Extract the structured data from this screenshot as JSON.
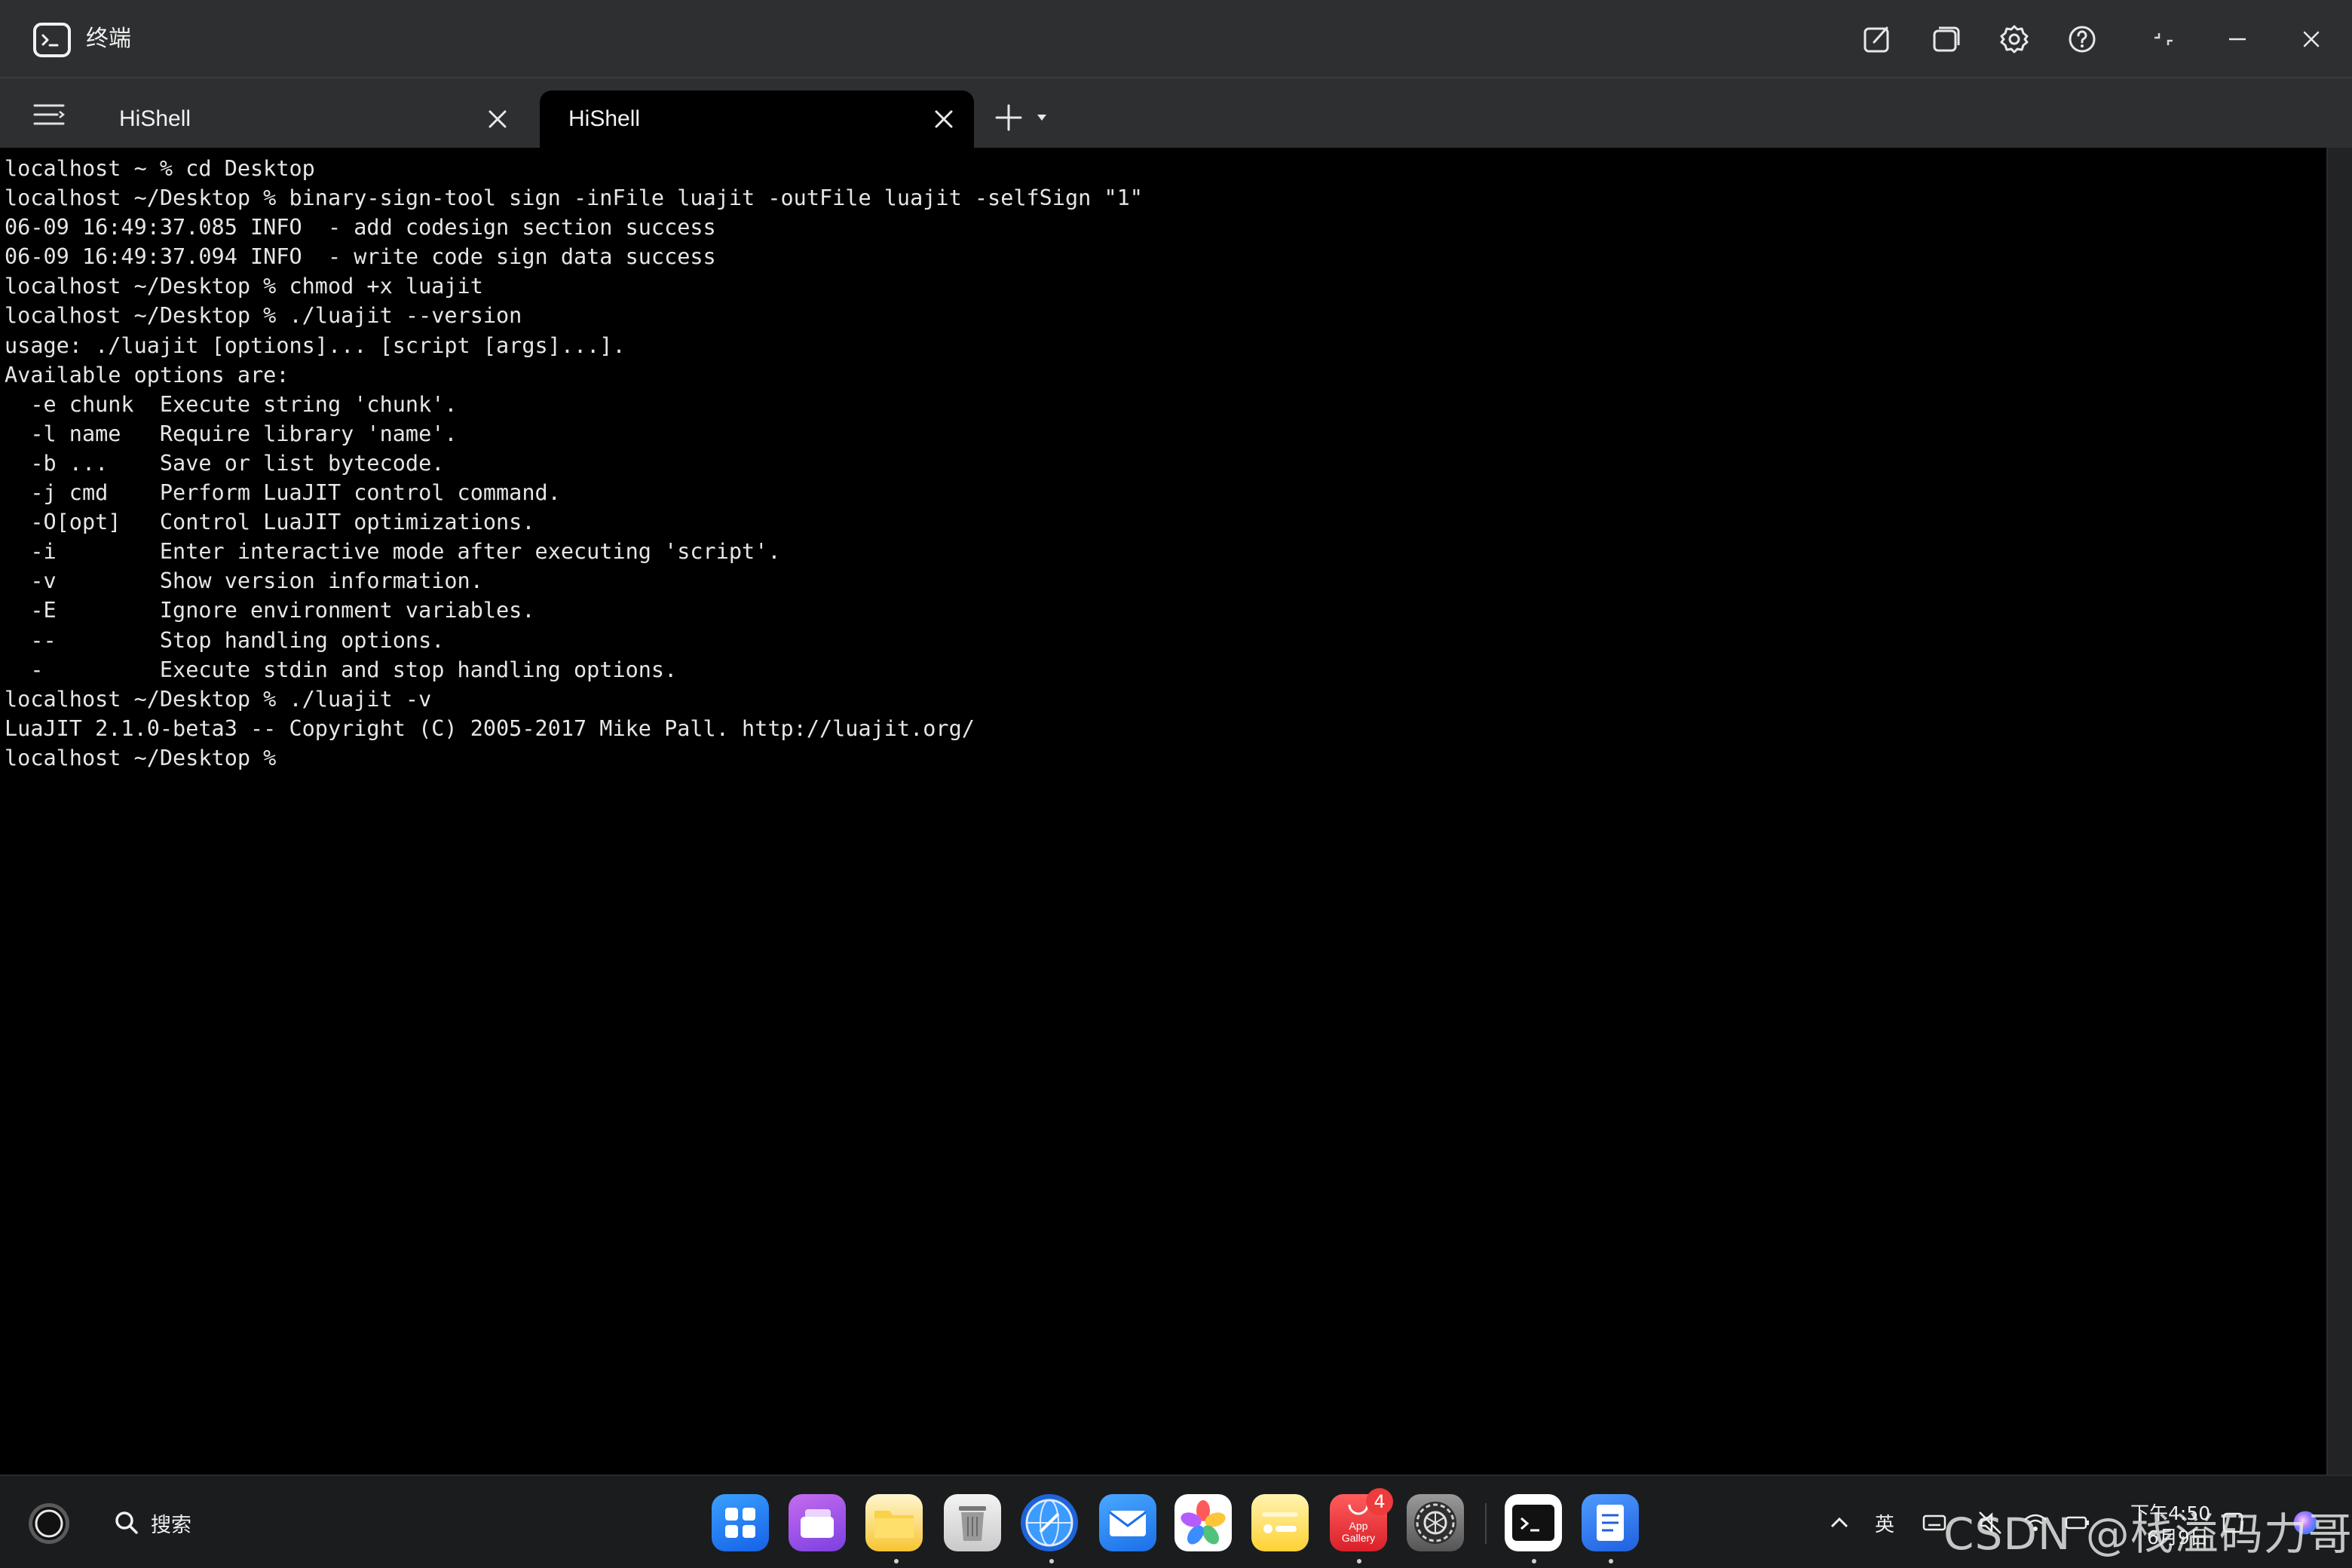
{
  "window": {
    "title": "终端"
  },
  "tabs": [
    {
      "label": "HiShell",
      "active": false
    },
    {
      "label": "HiShell",
      "active": true
    }
  ],
  "terminal": {
    "lines": [
      "localhost ~ % cd Desktop",
      "localhost ~/Desktop % binary-sign-tool sign -inFile luajit -outFile luajit -selfSign \"1\"",
      "06-09 16:49:37.085 INFO  - add codesign section success",
      "06-09 16:49:37.094 INFO  - write code sign data success",
      "localhost ~/Desktop % chmod +x luajit",
      "localhost ~/Desktop % ./luajit --version",
      "usage: ./luajit [options]... [script [args]...].",
      "Available options are:",
      "  -e chunk  Execute string 'chunk'.",
      "  -l name   Require library 'name'.",
      "  -b ...    Save or list bytecode.",
      "  -j cmd    Perform LuaJIT control command.",
      "  -O[opt]   Control LuaJIT optimizations.",
      "  -i        Enter interactive mode after executing 'script'.",
      "  -v        Show version information.",
      "  -E        Ignore environment variables.",
      "  --        Stop handling options.",
      "  -         Execute stdin and stop handling options.",
      "localhost ~/Desktop % ./luajit -v",
      "LuaJIT 2.1.0-beta3 -- Copyright (C) 2005-2017 Mike Pall. http://luajit.org/",
      "localhost ~/Desktop % "
    ]
  },
  "taskbar": {
    "search_label": "搜索",
    "appgallery_badge": "4",
    "appgallery_text_top": "App",
    "appgallery_text_bottom": "Gallery",
    "ime_label": "英",
    "clock_time": "下午4:50",
    "clock_date": "6月9日",
    "watermark": "CSDN @栈溢码力哥"
  },
  "colors": {
    "titlebar_bg": "#2e2f31",
    "terminal_bg": "#000000",
    "terminal_fg": "#e6e6e6",
    "taskbar_bg": "#1b1c1e"
  }
}
